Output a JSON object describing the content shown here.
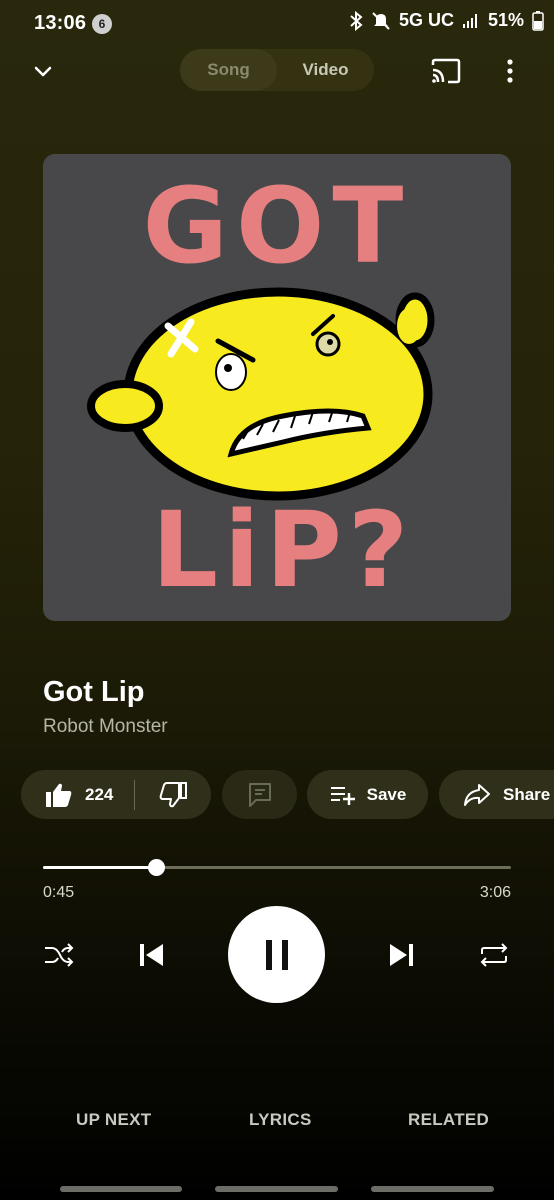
{
  "status_bar": {
    "time": "13:06",
    "notification_count": "6",
    "network": "5G UC",
    "battery": "51%"
  },
  "top_bar": {
    "tab_song": "Song",
    "tab_video": "Video",
    "active_tab": "Song"
  },
  "album_art": {
    "line1": "GOT",
    "line2": "LiP?"
  },
  "track": {
    "title": "Got Lip",
    "artist": "Robot Monster"
  },
  "actions": {
    "like_count": "224",
    "save_label": "Save",
    "share_label": "Share"
  },
  "progress": {
    "current": "0:45",
    "total": "3:06",
    "fraction": 0.242
  },
  "tabs": {
    "up_next": "UP NEXT",
    "lyrics": "LYRICS",
    "related": "RELATED"
  },
  "icons": [
    "chevron-down-icon",
    "cast-icon",
    "more-vert-icon",
    "thumb-up-icon",
    "thumb-down-icon",
    "comment-icon",
    "playlist-add-icon",
    "share-icon",
    "shuffle-icon",
    "skip-previous-icon",
    "pause-icon",
    "skip-next-icon",
    "repeat-icon",
    "bluetooth-icon",
    "mute-icon",
    "signal-icon",
    "battery-icon"
  ],
  "colors": {
    "background_top": "#29280c",
    "accent": "#ffffff",
    "chip_bg": "#2f2f1a",
    "album_bg": "#48484a",
    "art_text": "#e57f80",
    "art_face": "#f7ea1e"
  }
}
